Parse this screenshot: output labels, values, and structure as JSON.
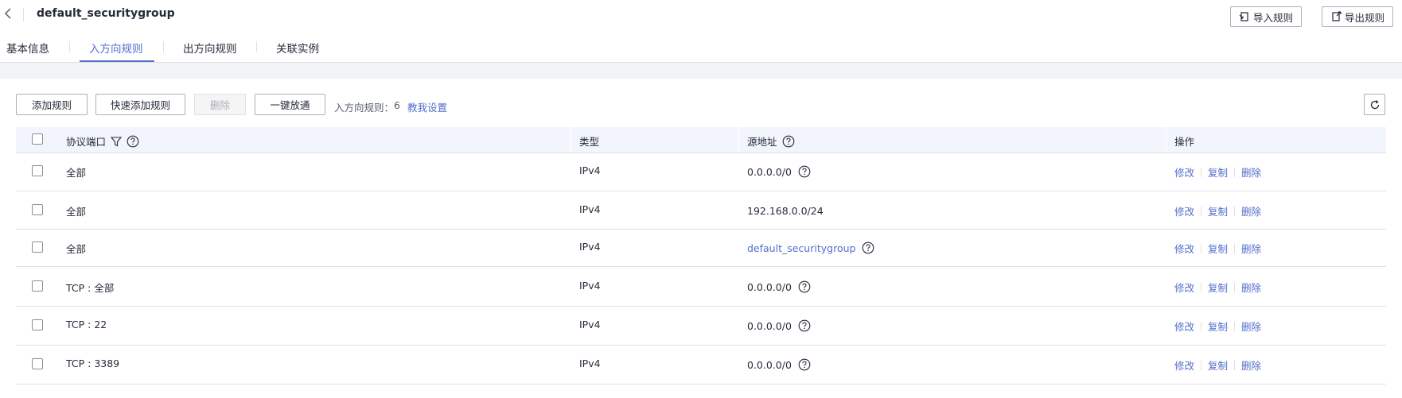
{
  "header": {
    "title": "default_securitygroup",
    "import_label": "导入规则",
    "export_label": "导出规则"
  },
  "tabs": [
    {
      "label": "基本信息"
    },
    {
      "label": "入方向规则",
      "active": true
    },
    {
      "label": "出方向规则"
    },
    {
      "label": "关联实例"
    }
  ],
  "toolbar": {
    "add_label": "添加规则",
    "quick_add_label": "快速添加规则",
    "delete_label": "删除",
    "open_all_label": "一键放通",
    "count_label": "入方向规则：",
    "count_value": "6",
    "help_link": "教我设置"
  },
  "table": {
    "columns": [
      "协议端口",
      "类型",
      "源地址",
      "操作"
    ],
    "rows": [
      {
        "protocol": "全部",
        "type": "IPv4",
        "source": "0.0.0.0/0",
        "source_is_link": false,
        "source_help": true
      },
      {
        "protocol": "全部",
        "type": "IPv4",
        "source": "192.168.0.0/24",
        "source_is_link": false,
        "source_help": false
      },
      {
        "protocol": "全部",
        "type": "IPv4",
        "source": "default_securitygroup",
        "source_is_link": true,
        "source_help": true
      },
      {
        "protocol": "TCP : 全部",
        "type": "IPv4",
        "source": "0.0.0.0/0",
        "source_is_link": false,
        "source_help": true
      },
      {
        "protocol": "TCP : 22",
        "type": "IPv4",
        "source": "0.0.0.0/0",
        "source_is_link": false,
        "source_help": true
      },
      {
        "protocol": "TCP : 3389",
        "type": "IPv4",
        "source": "0.0.0.0/0",
        "source_is_link": false,
        "source_help": true
      }
    ],
    "actions": [
      "修改",
      "复制",
      "删除"
    ]
  },
  "colors": {
    "accent": "#526ecc",
    "text": "#252b3a",
    "border": "#dfe1e6",
    "header_bg": "#f2f5fc"
  },
  "icons": {
    "back": "chevron-left-icon",
    "import": "import-icon",
    "export": "export-icon",
    "filter": "filter-icon",
    "help": "question-circle-icon",
    "refresh": "refresh-icon"
  }
}
